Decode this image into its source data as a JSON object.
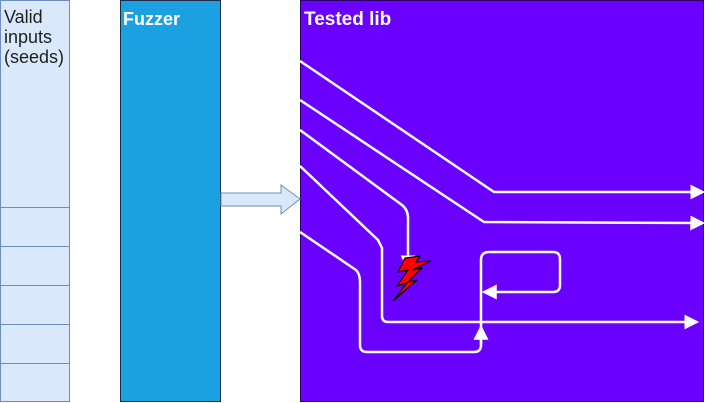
{
  "seeds": {
    "label": "Valid\ninputs\n(seeds)",
    "fill": "#dae8fc",
    "stroke": "#6c8ebf",
    "cell_count": 6
  },
  "fuzzer": {
    "label": "Fuzzer",
    "fill": "#1ba1e2"
  },
  "tested_lib": {
    "label": "Tested lib",
    "fill": "#6a00ff"
  },
  "connector": {
    "from": "Fuzzer",
    "to": "Tested lib",
    "fill": "#dae8fc",
    "stroke": "#6c8ebf"
  },
  "execution_paths": [
    {
      "id": "path-1",
      "outcome": "exits-lib"
    },
    {
      "id": "path-2",
      "outcome": "exits-lib"
    },
    {
      "id": "path-3",
      "outcome": "crash"
    },
    {
      "id": "path-4",
      "outcome": "exits-lib"
    },
    {
      "id": "path-5",
      "outcome": "loop"
    }
  ],
  "crash_marker": {
    "icon": "lightning-bolt-icon",
    "fill": "#ff0000",
    "stroke": "#000000"
  },
  "path_color": "#ffffff"
}
